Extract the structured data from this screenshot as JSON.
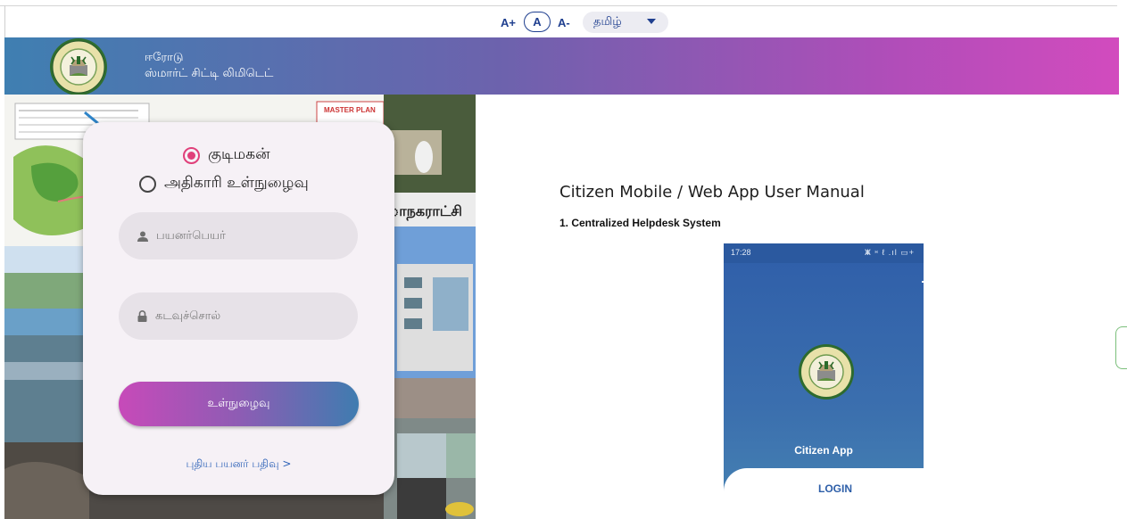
{
  "accessibility": {
    "font_increase": "A+",
    "font_normal": "A",
    "font_decrease": "A-",
    "language": "தமிழ்"
  },
  "header": {
    "line1": "ஈரோடு",
    "line2": "ஸ்மார்ட் சிட்டி லிமிடெட்",
    "logo_text_top": "ERODE SMART CITY LTD.",
    "logo_text_bottom": "ERODE",
    "gradient": [
      "#3f7fb1",
      "#6d62ad",
      "#d24bbe"
    ]
  },
  "collage": {
    "map_caption": "MASTER PLAN",
    "banner_text": "ாநகராட்சி"
  },
  "login": {
    "role_citizen": "குடிமகன்",
    "role_official": "அதிகாரி உள்நுழைவு",
    "selected_role": "குடிமகன்",
    "username_placeholder": "பயனர்பெயர்",
    "password_placeholder": "கடவுச்சொல்",
    "submit_label": "உள்நுழைவு",
    "register_link": "புதிய பயனர் பதிவு >"
  },
  "manual": {
    "title": "Citizen Mobile / Web App User Manual",
    "section": "1. Centralized Helpdesk System",
    "phone": {
      "time": "17:28",
      "status_icons": "ⵥ ᵸ ℓ .ıl ▭+",
      "app_name": "Citizen App",
      "login_label": "LOGIN"
    }
  },
  "colors": {
    "accent": "#1f3f8f",
    "radio_selected": "#e0407a",
    "link": "#2f63b8"
  }
}
